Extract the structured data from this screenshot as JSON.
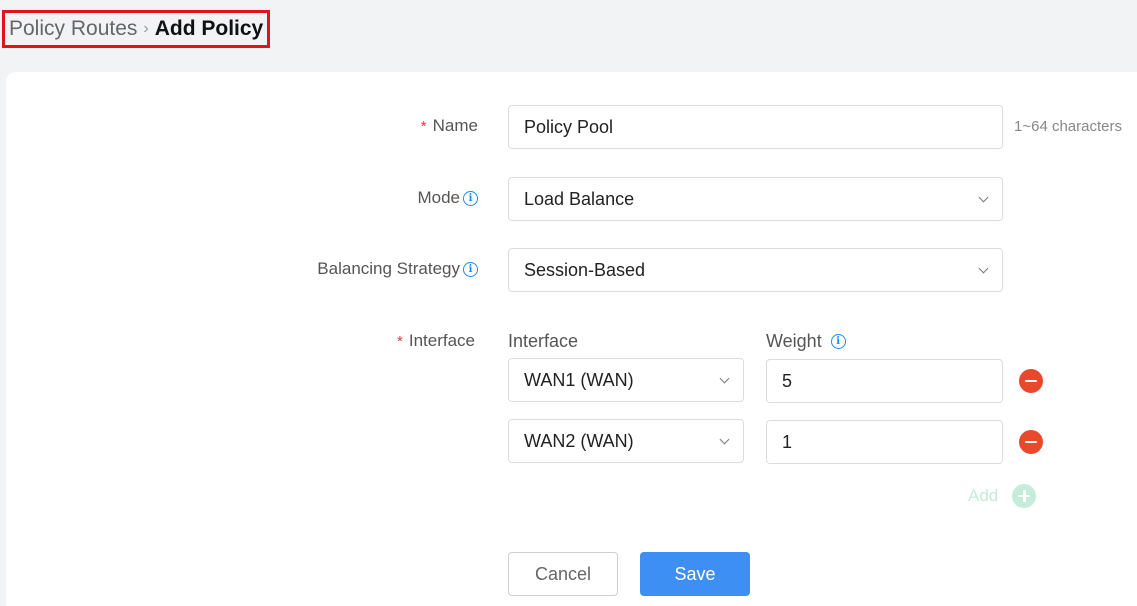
{
  "breadcrumb": {
    "parent": "Policy Routes",
    "separator": ">",
    "current": "Add Policy"
  },
  "form": {
    "name": {
      "label": "Name",
      "required_mark": "*",
      "value": "Policy Pool",
      "hint": "1~64 characters"
    },
    "mode": {
      "label": "Mode",
      "value": "Load Balance"
    },
    "strategy": {
      "label": "Balancing Strategy",
      "value": "Session-Based"
    },
    "interface": {
      "label": "Interface",
      "required_mark": "*",
      "col_interface": "Interface",
      "col_weight": "Weight",
      "rows": [
        {
          "interface": "WAN1 (WAN)",
          "weight": "5"
        },
        {
          "interface": "WAN2 (WAN)",
          "weight": "1"
        }
      ],
      "add_label": "Add"
    },
    "info_glyph": "i"
  },
  "actions": {
    "cancel": "Cancel",
    "save": "Save"
  },
  "colors": {
    "primary": "#3d8ff3",
    "danger": "#e8492d",
    "add_disabled": "#c4ecd8",
    "highlight_border": "#e0141e"
  }
}
